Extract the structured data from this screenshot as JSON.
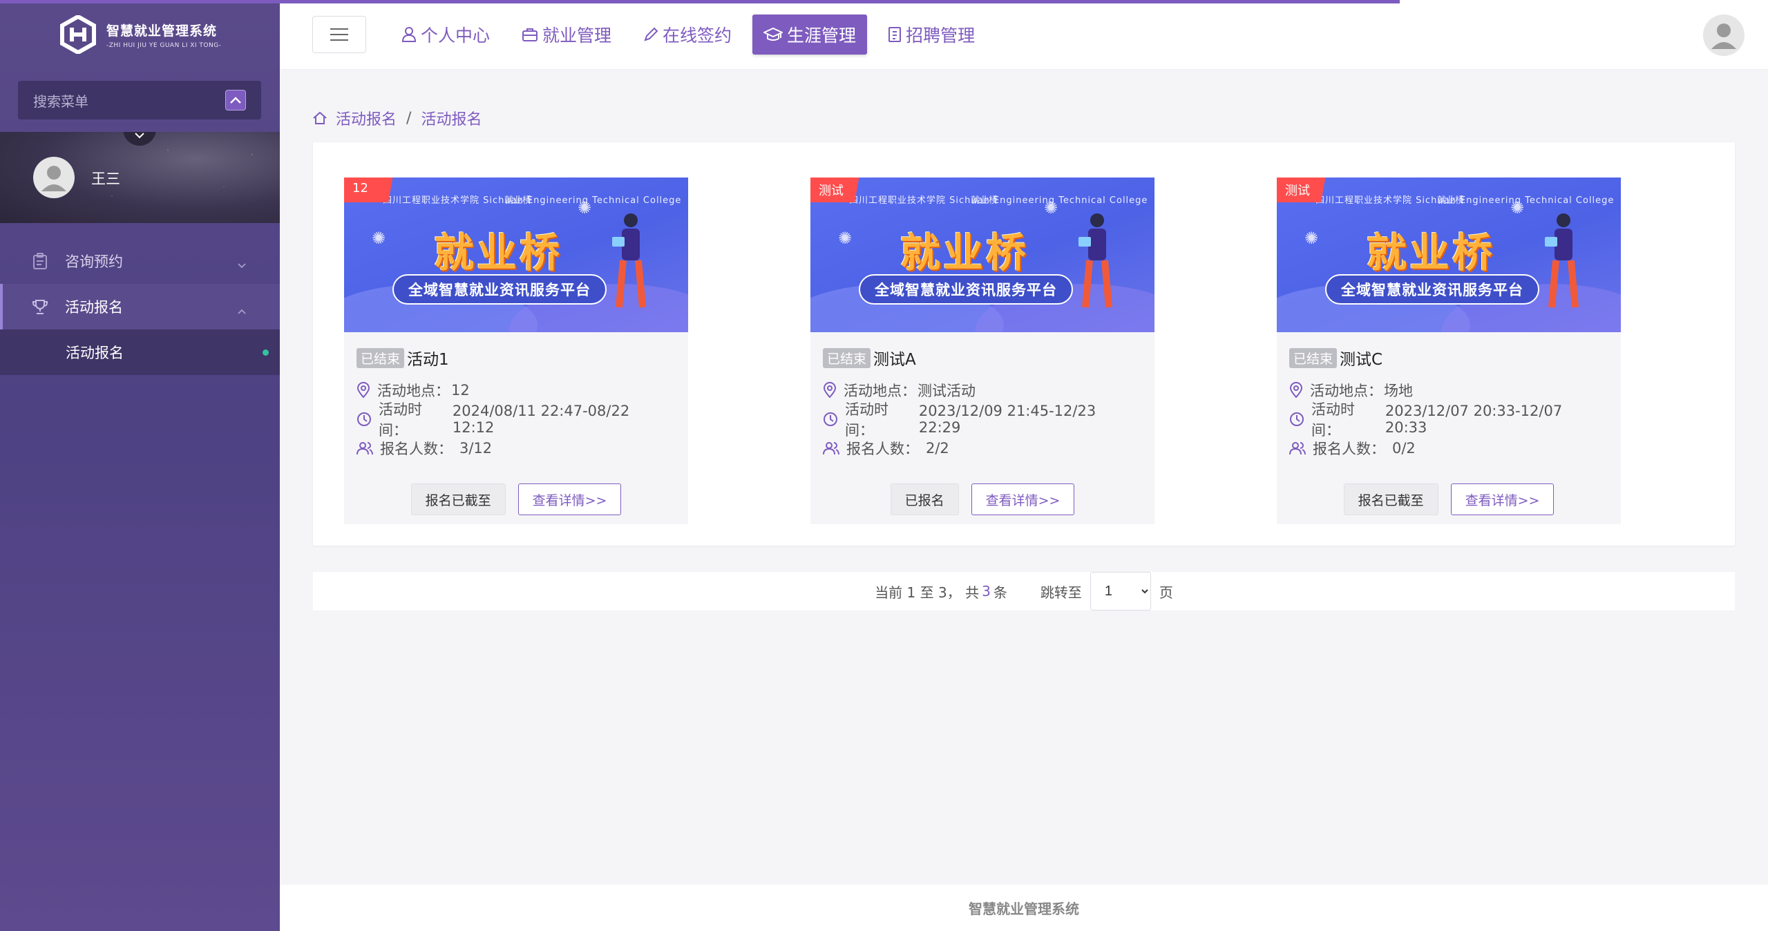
{
  "app": {
    "logo_title": "智慧就业管理系统",
    "logo_subtitle": "-ZHI HUI JIU YE GUAN LI XI TONG-"
  },
  "sidebar": {
    "search_placeholder": "搜索菜单",
    "user_name": "王三",
    "menu": [
      {
        "label": "咨询预约",
        "icon": "clipboard-icon",
        "expanded": false
      },
      {
        "label": "活动报名",
        "icon": "trophy-icon",
        "expanded": true
      }
    ],
    "submenu": [
      {
        "label": "活动报名",
        "active": true
      }
    ]
  },
  "header": {
    "nav": [
      {
        "label": "个人中心",
        "icon": "user-icon"
      },
      {
        "label": "就业管理",
        "icon": "briefcase-icon"
      },
      {
        "label": "在线签约",
        "icon": "pen-icon"
      },
      {
        "label": "生涯管理",
        "icon": "graduation-cap-icon",
        "active": true
      },
      {
        "label": "招聘管理",
        "icon": "document-icon"
      }
    ]
  },
  "breadcrumb": [
    "活动报名",
    "活动报名"
  ],
  "banner": {
    "college": "四川工程职业技术学院 Sichuan Engineering Technical College",
    "brand": "就业桥",
    "headline": "就业桥",
    "slogan": "全域智慧就业资讯服务平台"
  },
  "cards": [
    {
      "ribbon": "12",
      "status": "已结束",
      "title": "活动1",
      "location_label": "活动地点：",
      "location": "12",
      "time_label": "活动时间：",
      "time": "2024/08/11 22:47-08/22 12:12",
      "count_label": "报名人数：",
      "count": "3/12",
      "primary_button": "报名已截至",
      "detail_button": "查看详情>>"
    },
    {
      "ribbon": "测试",
      "status": "已结束",
      "title": "测试A",
      "location_label": "活动地点：",
      "location": "测试活动",
      "time_label": "活动时间：",
      "time": "2023/12/09 21:45-12/23 22:29",
      "count_label": "报名人数：",
      "count": "2/2",
      "primary_button": "已报名",
      "detail_button": "查看详情>>"
    },
    {
      "ribbon": "测试",
      "status": "已结束",
      "title": "测试C",
      "location_label": "活动地点：",
      "location": "场地",
      "time_label": "活动时间：",
      "time": "2023/12/07 20:33-12/07 20:33",
      "count_label": "报名人数：",
      "count": "0/2",
      "primary_button": "报名已截至",
      "detail_button": "查看详情>>"
    }
  ],
  "pager": {
    "prefix": "当前 1 至 3， 共",
    "total": "3",
    "suffix": "条",
    "jump_label": "跳转至",
    "page_value": "1",
    "page_unit": "页"
  },
  "footer": "智慧就业管理系统",
  "colors": {
    "accent": "#7e5bbf",
    "sidebar": "#4e4283",
    "ribbon": "#ff4d4d",
    "active_dot": "#34c3a0"
  }
}
